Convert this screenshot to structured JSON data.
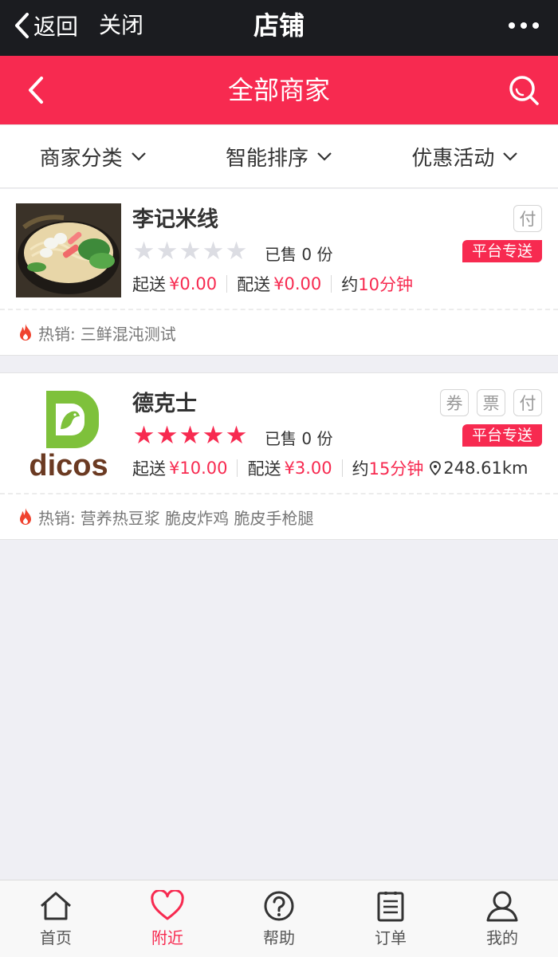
{
  "wechat": {
    "back_label": "返回",
    "close_label": "关闭",
    "title": "店铺"
  },
  "header": {
    "title": "全部商家"
  },
  "filters": [
    {
      "label": "商家分类"
    },
    {
      "label": "智能排序"
    },
    {
      "label": "优惠活动"
    }
  ],
  "shops": [
    {
      "name": "李记米线",
      "rating": 0,
      "sold": "已售 0 份",
      "min_order_label": "起送",
      "min_order_value": "¥0.00",
      "delivery_fee_label": "配送",
      "delivery_fee_value": "¥0.00",
      "time_label": "约",
      "time_value": "10分钟",
      "distance": "",
      "tags": [
        "付"
      ],
      "badge": "平台专送",
      "hot_label": "热销:",
      "hot_items": "三鲜混沌测试"
    },
    {
      "name": "德克士",
      "rating": 5,
      "sold": "已售 0 份",
      "min_order_label": "起送",
      "min_order_value": "¥10.00",
      "delivery_fee_label": "配送",
      "delivery_fee_value": "¥3.00",
      "time_label": "约",
      "time_value": "15分钟",
      "distance": "248.61km",
      "tags": [
        "券",
        "票",
        "付"
      ],
      "badge": "平台专送",
      "hot_label": "热销:",
      "hot_items": "营养热豆浆 脆皮炸鸡 脆皮手枪腿",
      "logo_text": "dicos"
    }
  ],
  "tabbar": [
    {
      "label": "首页",
      "icon": "home-icon",
      "active": false
    },
    {
      "label": "附近",
      "icon": "heart-icon",
      "active": true
    },
    {
      "label": "帮助",
      "icon": "help-icon",
      "active": false
    },
    {
      "label": "订单",
      "icon": "order-icon",
      "active": false
    },
    {
      "label": "我的",
      "icon": "user-icon",
      "active": false
    }
  ],
  "colors": {
    "accent": "#f72a50",
    "wechat_bar": "#1b1c20",
    "background": "#efeff4"
  }
}
